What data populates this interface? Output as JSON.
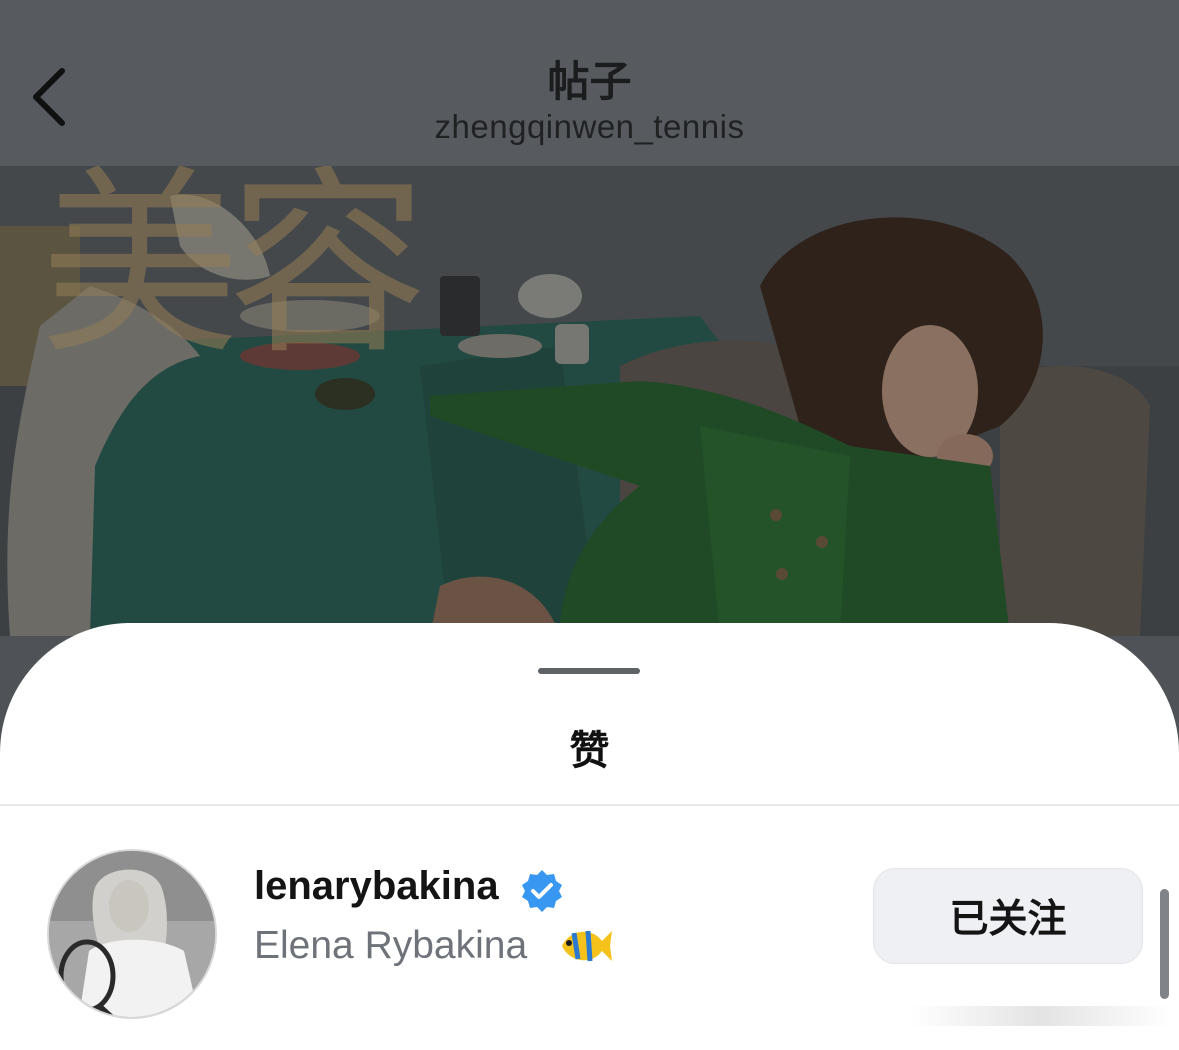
{
  "nav": {
    "title": "帖子",
    "subtitle": "zhengqinwen_tennis",
    "back_icon": "chevron-left-icon"
  },
  "photo": {
    "overlay_text": "美容"
  },
  "sheet": {
    "title": "赞"
  },
  "likes": [
    {
      "username": "lenarybakina",
      "verified": true,
      "full_name": "Elena Rybakina",
      "emoji": "tropical-fish-icon",
      "follow_label": "已关注"
    }
  ],
  "colors": {
    "verified_badge": "#3897f0",
    "follow_button_bg": "#eef0f3",
    "secondary_text": "#6e737a"
  }
}
